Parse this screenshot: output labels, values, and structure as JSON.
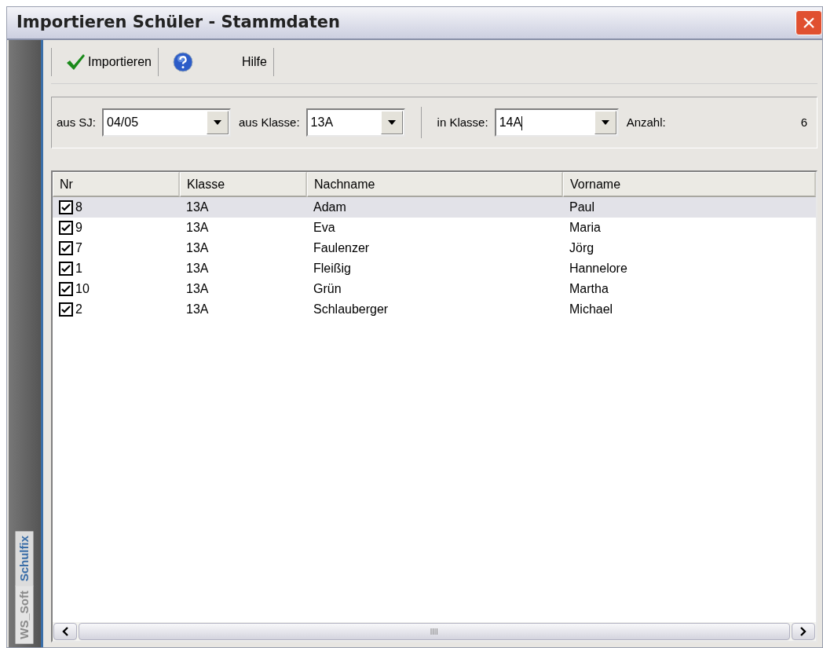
{
  "window": {
    "title": "Importieren Schüler - Stammdaten",
    "close": "×"
  },
  "sidebar": {
    "brand_prefix": "WS_Soft",
    "brand": "Schulfix"
  },
  "toolbar": [
    {
      "kind": "import",
      "label": "Importieren"
    },
    {
      "kind": "help",
      "label": "Hilfe"
    }
  ],
  "filters": {
    "school_year": {
      "label": "aus SJ:",
      "value": "04/05"
    },
    "from_class": {
      "label": "aus Klasse:",
      "value": "13A"
    },
    "to_class": {
      "label": "in Klasse:",
      "value": "14A"
    },
    "count": {
      "label": "Anzahl:",
      "value": "6"
    }
  },
  "table": {
    "columns": [
      "Nr",
      "Klasse",
      "Nachname",
      "Vorname"
    ],
    "rows": [
      {
        "checked": true,
        "selected": true,
        "cells": [
          "8",
          "13A",
          "Adam",
          "Paul"
        ]
      },
      {
        "checked": true,
        "selected": false,
        "cells": [
          "9",
          "13A",
          "Eva",
          "Maria"
        ]
      },
      {
        "checked": true,
        "selected": false,
        "cells": [
          "7",
          "13A",
          "Faulenzer",
          "Jörg"
        ]
      },
      {
        "checked": true,
        "selected": false,
        "cells": [
          "1",
          "13A",
          "Fleißig",
          "Hannelore"
        ]
      },
      {
        "checked": true,
        "selected": false,
        "cells": [
          "10",
          "13A",
          "Grün",
          "Martha"
        ]
      },
      {
        "checked": true,
        "selected": false,
        "cells": [
          "2",
          "13A",
          "Schlauberger",
          "Michael"
        ]
      }
    ]
  }
}
